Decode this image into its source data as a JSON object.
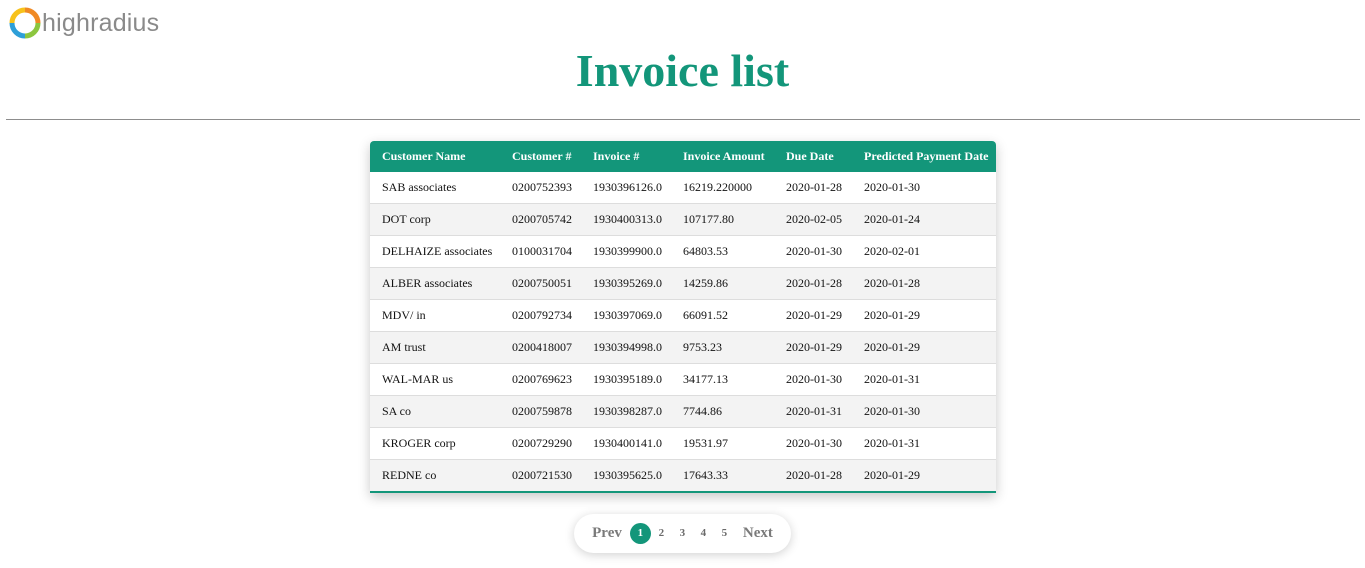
{
  "brand": {
    "name": "highradius",
    "accent": "#13967a"
  },
  "page": {
    "title": "Invoice list"
  },
  "table": {
    "columns": [
      "Customer Name",
      "Customer #",
      "Invoice #",
      "Invoice Amount",
      "Due Date",
      "Predicted Payment Date"
    ],
    "rows": [
      [
        "SAB associates",
        "0200752393",
        "1930396126.0",
        "16219.220000",
        "2020-01-28",
        "2020-01-30"
      ],
      [
        "DOT corp",
        "0200705742",
        "1930400313.0",
        "107177.80",
        "2020-02-05",
        "2020-01-24"
      ],
      [
        "DELHAIZE associates",
        "0100031704",
        "1930399900.0",
        "64803.53",
        "2020-01-30",
        "2020-02-01"
      ],
      [
        "ALBER associates",
        "0200750051",
        "1930395269.0",
        "14259.86",
        "2020-01-28",
        "2020-01-28"
      ],
      [
        "MDV/ in",
        "0200792734",
        "1930397069.0",
        "66091.52",
        "2020-01-29",
        "2020-01-29"
      ],
      [
        "AM trust",
        "0200418007",
        "1930394998.0",
        "9753.23",
        "2020-01-29",
        "2020-01-29"
      ],
      [
        "WAL-MAR us",
        "0200769623",
        "1930395189.0",
        "34177.13",
        "2020-01-30",
        "2020-01-31"
      ],
      [
        "SA co",
        "0200759878",
        "1930398287.0",
        "7744.86",
        "2020-01-31",
        "2020-01-30"
      ],
      [
        "KROGER corp",
        "0200729290",
        "1930400141.0",
        "19531.97",
        "2020-01-30",
        "2020-01-31"
      ],
      [
        "REDNE co",
        "0200721530",
        "1930395625.0",
        "17643.33",
        "2020-01-28",
        "2020-01-29"
      ]
    ]
  },
  "pagination": {
    "prev_label": "Prev",
    "next_label": "Next",
    "pages": [
      "1",
      "2",
      "3",
      "4",
      "5"
    ],
    "current": "1"
  }
}
